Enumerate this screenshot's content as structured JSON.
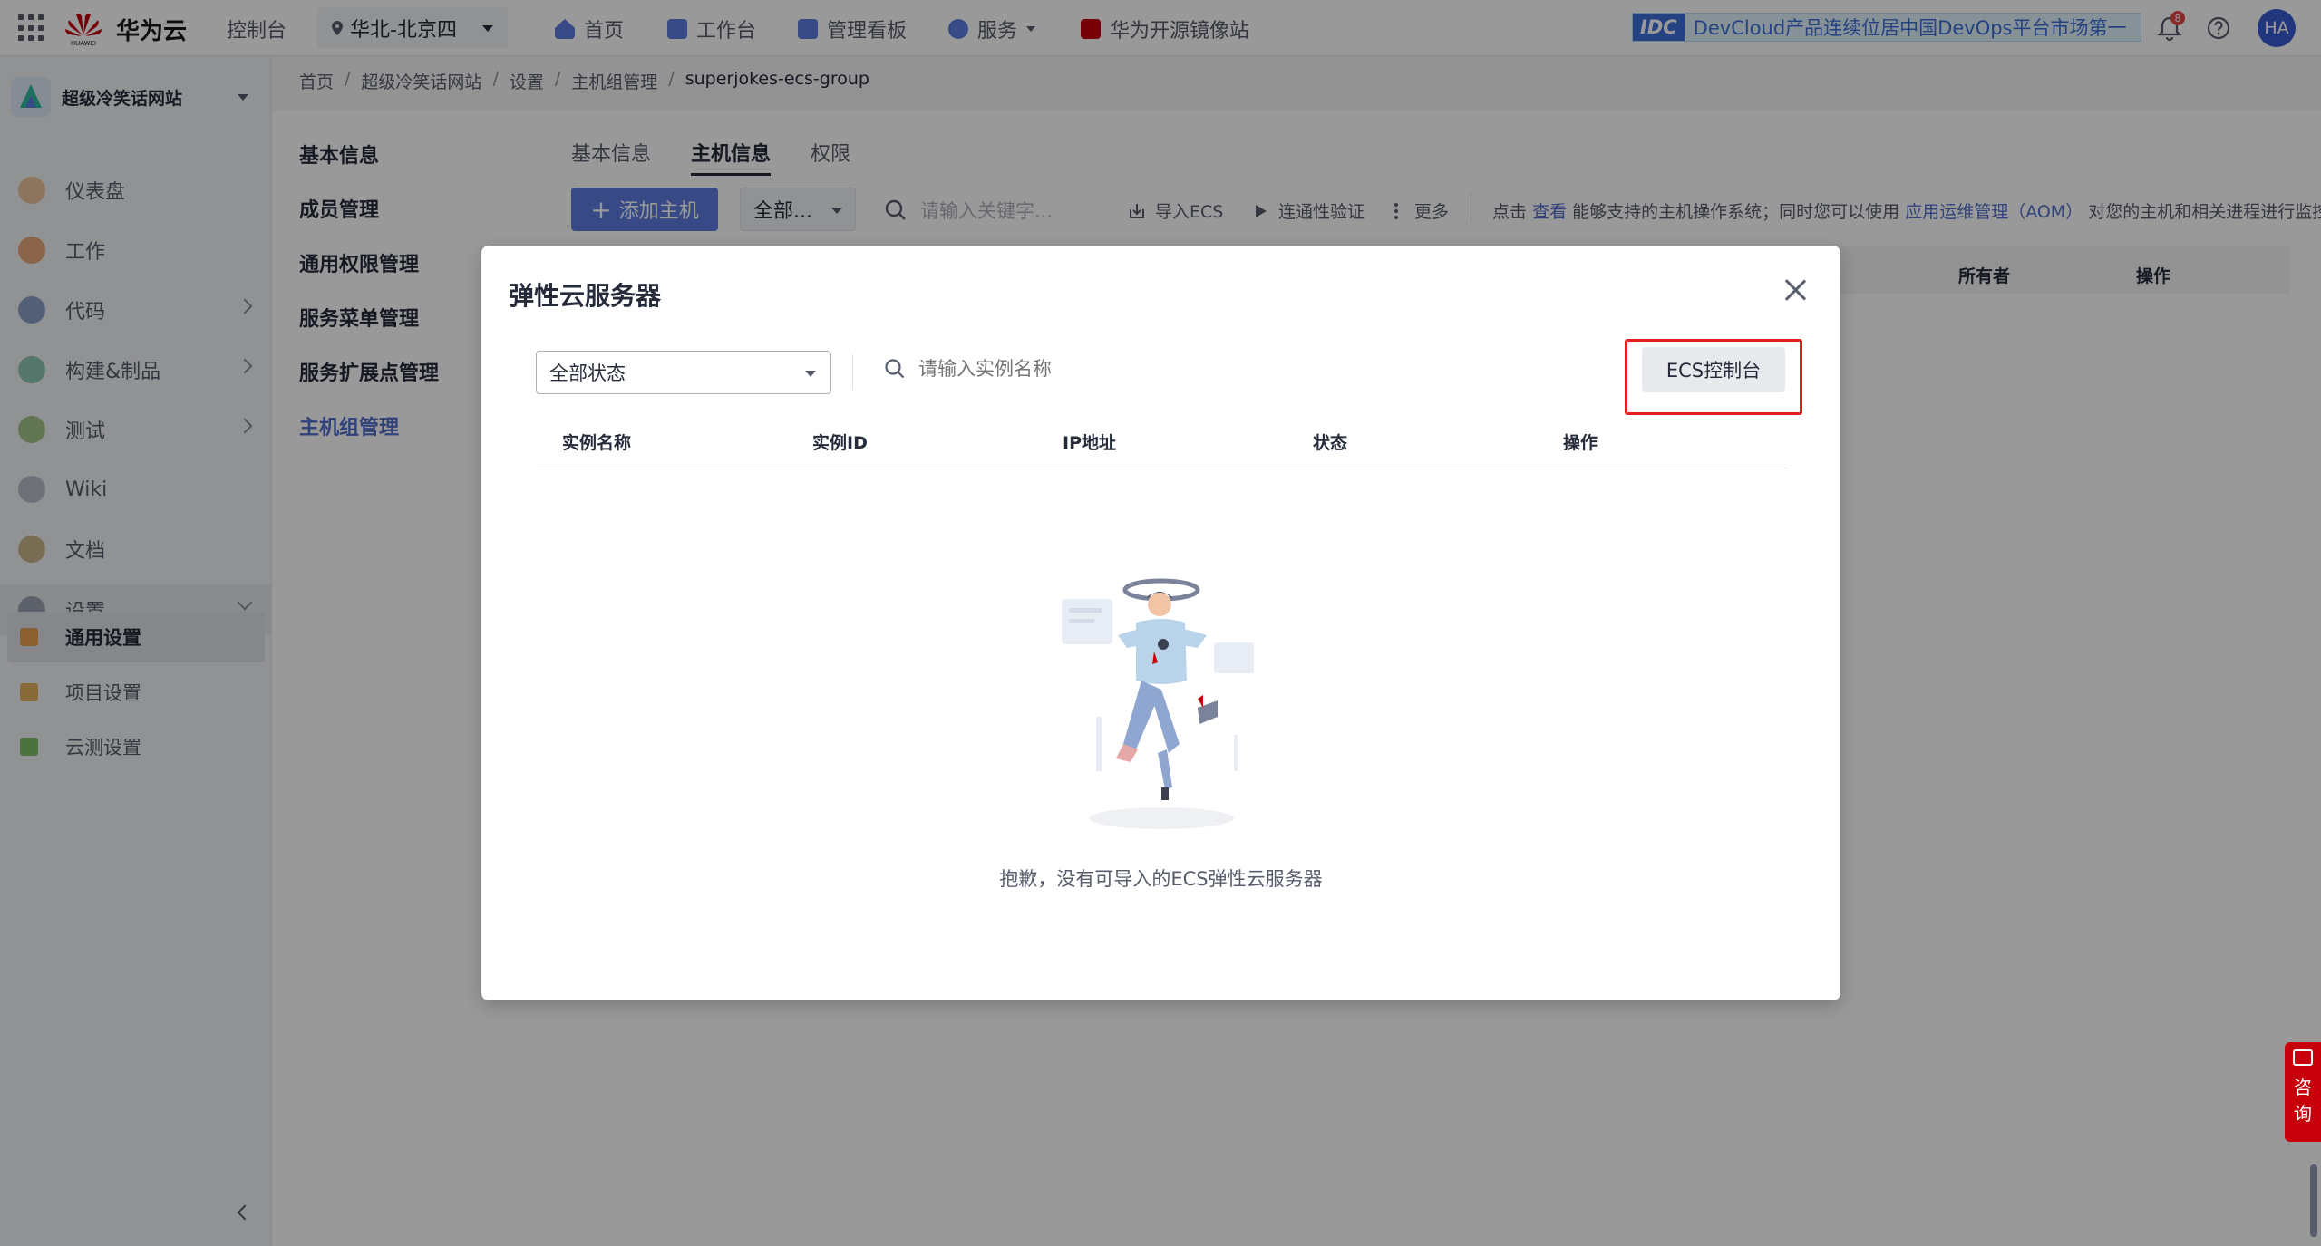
{
  "topbar": {
    "brand": "华为云",
    "logo_text": "HUAWEI",
    "console": "控制台",
    "region": "华北-北京四",
    "nav": [
      {
        "label": "首页",
        "icon": "home-icon"
      },
      {
        "label": "工作台",
        "icon": "workbench-icon"
      },
      {
        "label": "管理看板",
        "icon": "dashboard-icon"
      },
      {
        "label": "服务",
        "icon": "service-icon"
      },
      {
        "label": "华为开源镜像站",
        "icon": "mirror-icon"
      }
    ],
    "banner_tag": "IDC",
    "banner_text": "DevCloud产品连续位居中国DevOps平台市场第一",
    "notification_count": "8",
    "avatar": "HA"
  },
  "sidebar": {
    "project": "超级冷笑话网站",
    "items": [
      {
        "label": "仪表盘"
      },
      {
        "label": "工作"
      },
      {
        "label": "代码"
      },
      {
        "label": "构建&制品"
      },
      {
        "label": "测试"
      },
      {
        "label": "Wiki"
      },
      {
        "label": "文档"
      },
      {
        "label": "设置"
      }
    ],
    "subitems": [
      {
        "label": "通用设置"
      },
      {
        "label": "项目设置"
      },
      {
        "label": "云测设置"
      }
    ]
  },
  "breadcrumb": [
    "首页",
    "超级冷笑话网站",
    "设置",
    "主机组管理",
    "superjokes-ecs-group"
  ],
  "submenu": [
    "基本信息",
    "成员管理",
    "通用权限管理",
    "服务菜单管理",
    "服务扩展点管理",
    "主机组管理"
  ],
  "content": {
    "tabs": [
      "基本信息",
      "主机信息",
      "权限"
    ],
    "add_host": "添加主机",
    "filter_all": "全部...",
    "search_placeholder": "请输入关键字...",
    "import_ecs": "导入ECS",
    "connectivity": "连通性验证",
    "more": "更多",
    "info_prefix": "点击",
    "info_link1": "查看",
    "info_mid": "能够支持的主机操作系统；同时您可以使用",
    "info_link2": "应用运维管理（AOM）",
    "info_suffix": "对您的主机和相关进程进行监控",
    "table_headers": [
      "所有者",
      "操作"
    ]
  },
  "modal": {
    "title": "弹性云服务器",
    "status_select": "全部状态",
    "search_placeholder": "请输入实例名称",
    "ecs_console": "ECS控制台",
    "columns": [
      "实例名称",
      "实例ID",
      "IP地址",
      "状态",
      "操作"
    ],
    "empty_text": "抱歉，没有可导入的ECS弹性云服务器"
  },
  "float": {
    "consult1": "咨",
    "consult2": "询"
  }
}
